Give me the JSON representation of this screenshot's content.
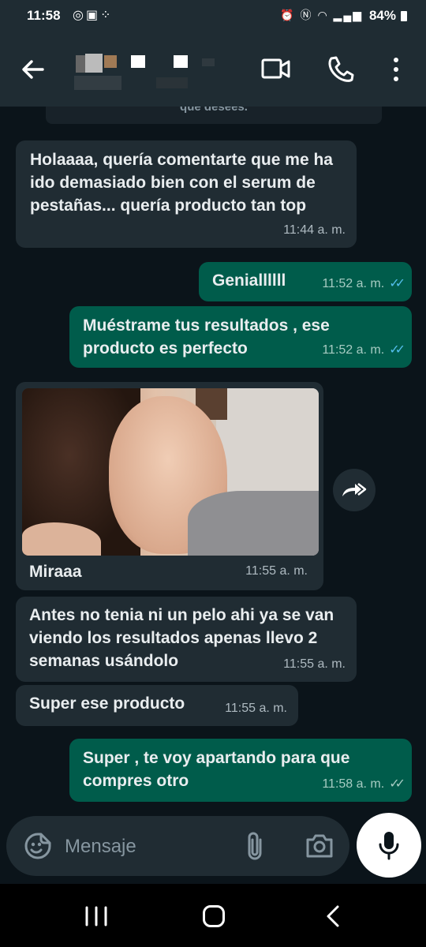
{
  "status_bar": {
    "time": "11:58",
    "left_icons": [
      "whatsapp-icon",
      "instagram-icon",
      "grid-icon"
    ],
    "right_icons": [
      "alarm-icon",
      "nfc-icon",
      "wifi-icon",
      "signal-icon"
    ],
    "battery": "84%"
  },
  "app_bar": {
    "icons": [
      "back-arrow-icon",
      "video-call-icon",
      "phone-icon",
      "more-vert-icon"
    ]
  },
  "chat": {
    "system_message": "que desees.",
    "messages": [
      {
        "dir": "in",
        "text": "Holaaaa, quería comentarte que me ha ido demasiado bien con el serum de pestañas... quería producto tan top",
        "time": "11:44 a. m."
      },
      {
        "dir": "out",
        "text": "Geniallllll",
        "time": "11:52 a. m.",
        "ticks": "read"
      },
      {
        "dir": "out",
        "text": "Muéstrame tus resultados , ese producto es perfecto",
        "time": "11:52 a. m.",
        "ticks": "read"
      },
      {
        "dir": "in",
        "type": "image",
        "text": "Miraaa",
        "time": "11:55 a. m."
      },
      {
        "dir": "in",
        "text": "Antes no tenia ni un pelo ahi ya se van viendo los resultados apenas llevo 2 semanas usándolo",
        "time": "11:55 a. m."
      },
      {
        "dir": "in",
        "text": "Super ese producto",
        "time": "11:55 a. m."
      },
      {
        "dir": "out",
        "text": "Super , te voy apartando para que compres otro",
        "time": "11:58 a. m.",
        "ticks": "delivered"
      }
    ]
  },
  "input": {
    "placeholder": "Mensaje",
    "icons": [
      "emoji-sticker-icon",
      "attach-icon",
      "camera-icon",
      "microphone-icon"
    ]
  },
  "nav_bar": {
    "icons": [
      "recent-apps-icon",
      "home-icon",
      "back-icon"
    ]
  },
  "colors": {
    "background": "#0b141a",
    "incoming_bubble": "#202c33",
    "outgoing_bubble": "#005c4b",
    "read_ticks": "#53bdeb",
    "app_bar": "#1f2c33"
  }
}
